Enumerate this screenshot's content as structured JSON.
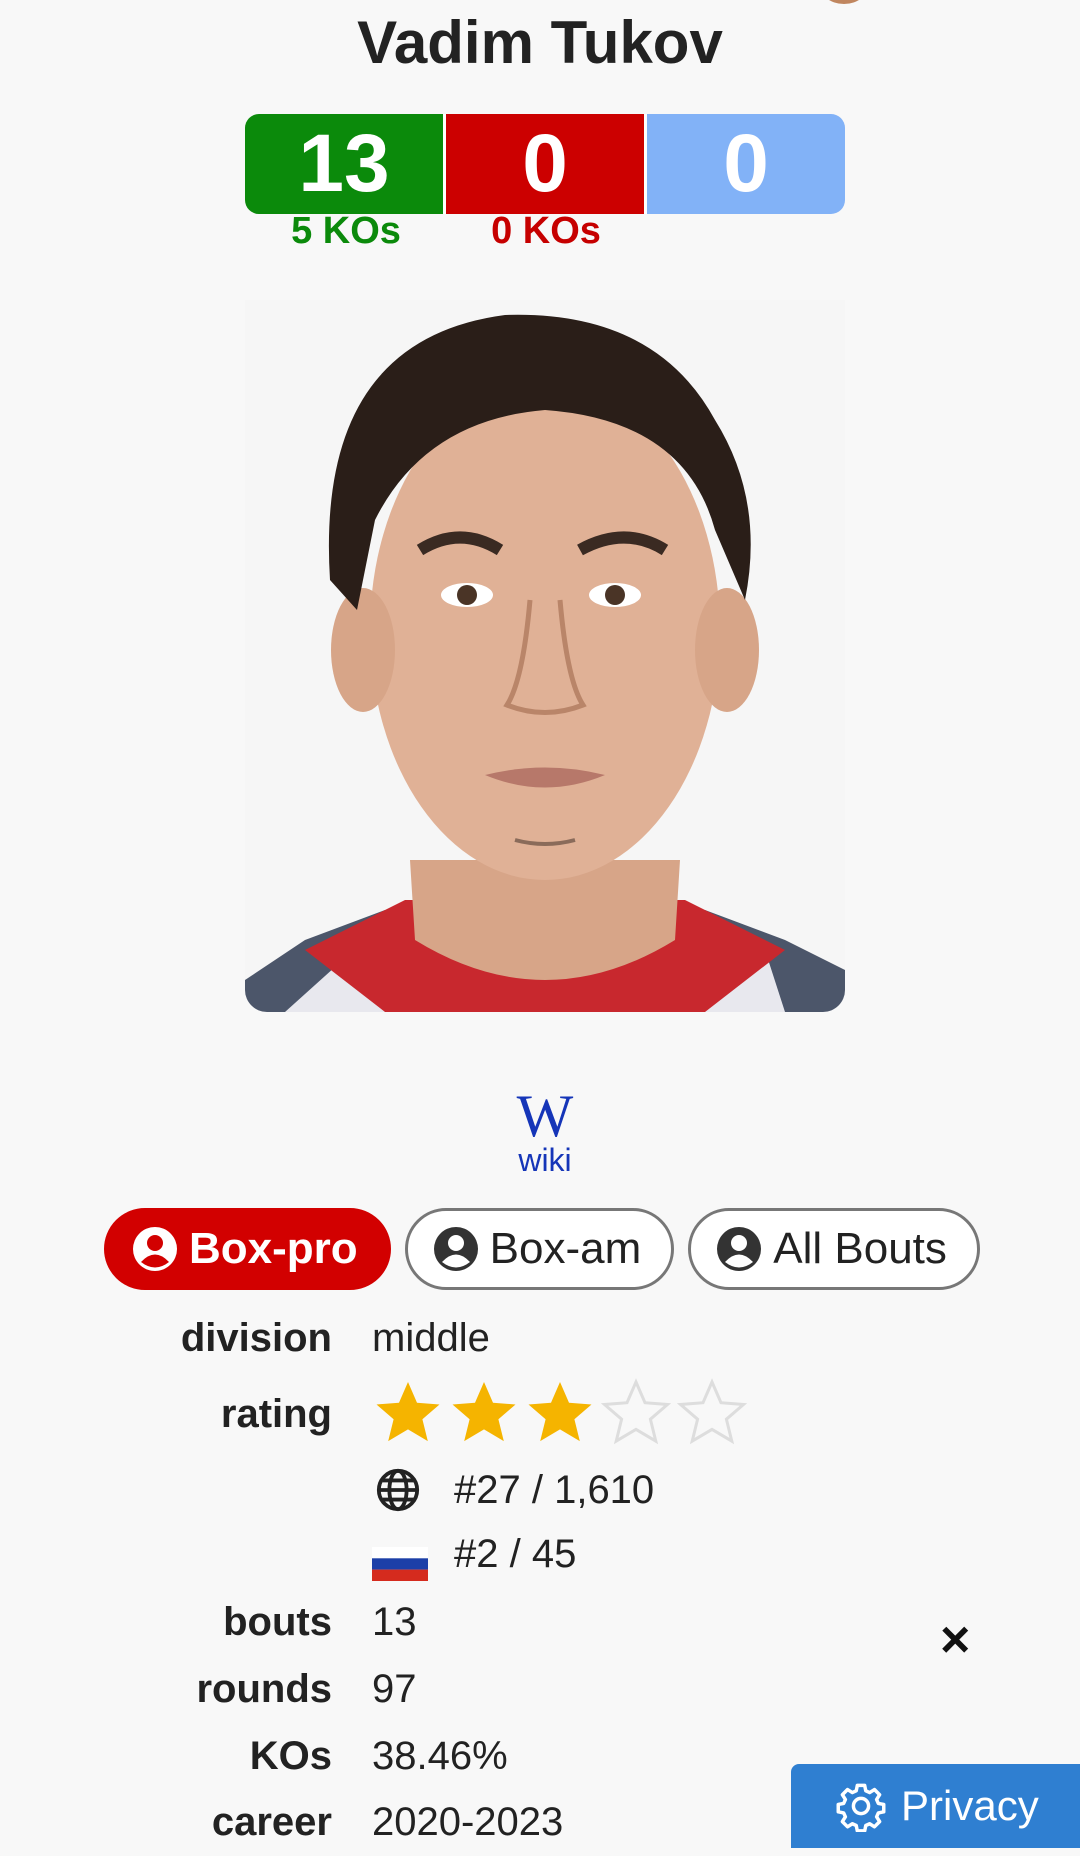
{
  "fighter": {
    "name": "Vadim Tukov"
  },
  "record": {
    "wins": "13",
    "losses": "0",
    "draws": "0",
    "wins_kos": "5 KOs",
    "losses_kos": "0 KOs"
  },
  "links": {
    "wiki_icon": "W",
    "wiki_label": "wiki"
  },
  "tabs": [
    {
      "label": "Box-pro",
      "active": true
    },
    {
      "label": "Box-am",
      "active": false
    },
    {
      "label": "All Bouts",
      "active": false
    }
  ],
  "details": {
    "division_label": "division",
    "division_value": "middle",
    "rating_label": "rating",
    "rating_stars": 3,
    "rating_max": 5,
    "world_rank": "#27 / 1,610",
    "country_rank": "#2 / 45",
    "bouts_label": "bouts",
    "bouts_value": "13",
    "rounds_label": "rounds",
    "rounds_value": "97",
    "kos_label": "KOs",
    "kos_value": "38.46%",
    "career_label": "career",
    "career_value": "2020-2023"
  },
  "overlay": {
    "close": "×",
    "privacy_label": "Privacy"
  },
  "colors": {
    "win": "#0b8a0b",
    "loss": "#cc0000",
    "draw": "#82b2f7",
    "active_tab": "#d20000",
    "star": "#f5b400",
    "privacy": "#2f7fd1",
    "wiki": "#1535b8"
  },
  "icons": {
    "tab_icon": "user-circle-icon",
    "globe": "globe-icon",
    "flag": "russia-flag-icon",
    "privacy": "gear-icon"
  }
}
